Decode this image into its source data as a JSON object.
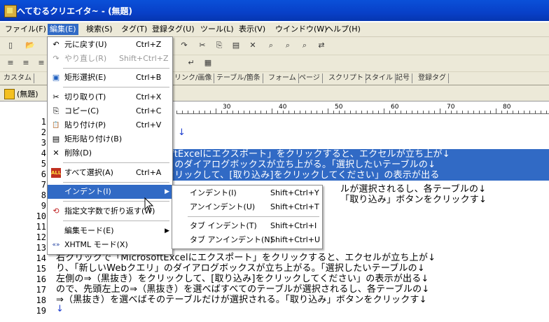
{
  "window": {
    "title": "へてむるクリエイタ~ - (無題)"
  },
  "menubar": [
    {
      "label": "ファイル(F)"
    },
    {
      "label": "編集(E)"
    },
    {
      "label": "検索(S)"
    },
    {
      "label": "タグ(T)"
    },
    {
      "label": "登録タグ(U)"
    },
    {
      "label": "ツール(L)"
    },
    {
      "label": "表示(V)"
    },
    {
      "label": "ウインドウ(W)"
    },
    {
      "label": "ヘルプ(H)"
    }
  ],
  "tabs": [
    "カスタム",
    "リンク/画像",
    "テーブル/箇条",
    "フォーム",
    "ページ",
    "スクリプト",
    "スタイル",
    "記号",
    "登録タグ"
  ],
  "doc_tab": {
    "label": "(無題)"
  },
  "ruler": [
    "30",
    "40",
    "50",
    "60",
    "70",
    "80"
  ],
  "edit_menu": {
    "items": [
      {
        "label": "元に戻す(U)",
        "shortcut": "Ctrl+Z",
        "icon": "undo-icon",
        "glyph": "↶"
      },
      {
        "label": "やり直し(R)",
        "shortcut": "Shift+Ctrl+Z",
        "icon": "redo-icon",
        "glyph": "↷"
      },
      {
        "label": "矩形選択(E)",
        "shortcut": "Ctrl+B",
        "icon": "rect-select-icon",
        "glyph": "▣"
      },
      {
        "label": "切り取り(T)",
        "shortcut": "Ctrl+X",
        "icon": "scissors-icon",
        "glyph": "✂"
      },
      {
        "label": "コピー(C)",
        "shortcut": "Ctrl+C",
        "icon": "copy-icon",
        "glyph": "⎘"
      },
      {
        "label": "貼り付け(P)",
        "shortcut": "Ctrl+V",
        "icon": "paste-icon",
        "glyph": "📋"
      },
      {
        "label": "矩形貼り付け(B)",
        "shortcut": "",
        "icon": "rect-paste-icon",
        "glyph": "▤"
      },
      {
        "label": "削除(D)",
        "shortcut": "",
        "icon": "delete-icon",
        "glyph": "✕"
      },
      {
        "label": "すべて選択(A)",
        "shortcut": "Ctrl+A",
        "icon": "select-all-icon",
        "glyph": "ALL"
      },
      {
        "label": "インデント(I)",
        "shortcut": "",
        "icon": "",
        "glyph": ""
      },
      {
        "label": "指定文字数で折り返す(W)",
        "shortcut": "",
        "icon": "wrap-icon",
        "glyph": "⟲"
      },
      {
        "label": "編集モード(E)",
        "shortcut": "",
        "icon": "",
        "glyph": ""
      },
      {
        "label": "XHTML モード(X)",
        "shortcut": "",
        "icon": "xhtml-icon",
        "glyph": "«»"
      }
    ]
  },
  "indent_submenu": {
    "items": [
      {
        "label": "インデント(I)",
        "shortcut": "Shift+Ctrl+Y"
      },
      {
        "label": "アンインデント(U)",
        "shortcut": "Shift+Ctrl+T"
      },
      {
        "label": "タブ インデント(T)",
        "shortcut": "Shift+Ctrl+I"
      },
      {
        "label": "タブ アンインデント(N)",
        "shortcut": "Shift+Ctrl+U"
      }
    ]
  },
  "editor": {
    "line_numbers": [
      "1",
      "2",
      "3",
      "4",
      "5",
      "6",
      "7",
      "8",
      "9",
      "10",
      "11",
      "12",
      "13",
      "14",
      "15",
      "16",
      "17",
      "18",
      "19"
    ],
    "visible_text": {
      "l3": "oftExcelにエクスポート」をクリックすると、エクセルが立ち上が↓",
      "l4": "」のダイアログボックスが立ち上がる。「選択したいテーブルの↓",
      "l5": "クリックして、[取り込み]をクリックしてください」の表示が出る",
      "l6": "ルが選択されるし、各テーブルの↓",
      "l7": "「取り込み」ボタンをクリックす↓",
      "l12": "右クリックで「MicrosoftExcelにエクスポート」をクリックすると、エクセルが立ち上が↓",
      "l13": "り、「新しいWebクエリ」のダイアログボックスが立ち上がる。「選択したいテーブルの↓",
      "l14": "左側の⇒（黒抜き）をクリックして、[取り込み]をクリックしてください」の表示が出る↓",
      "l15": "ので、先頭左上の⇒（黒抜き）を選べばすべてのテーブルが選択されるし、各テーブルの↓",
      "l16": "⇒（黒抜き）を選べばそのテーブルだけが選択される。「取り込み」ボタンをクリックす↓",
      "l17": "↓",
      "l18": "↓"
    }
  },
  "colors": {
    "selection": "#316ac5",
    "titlebar": "#0a50d8",
    "chrome": "#ece9d8"
  }
}
